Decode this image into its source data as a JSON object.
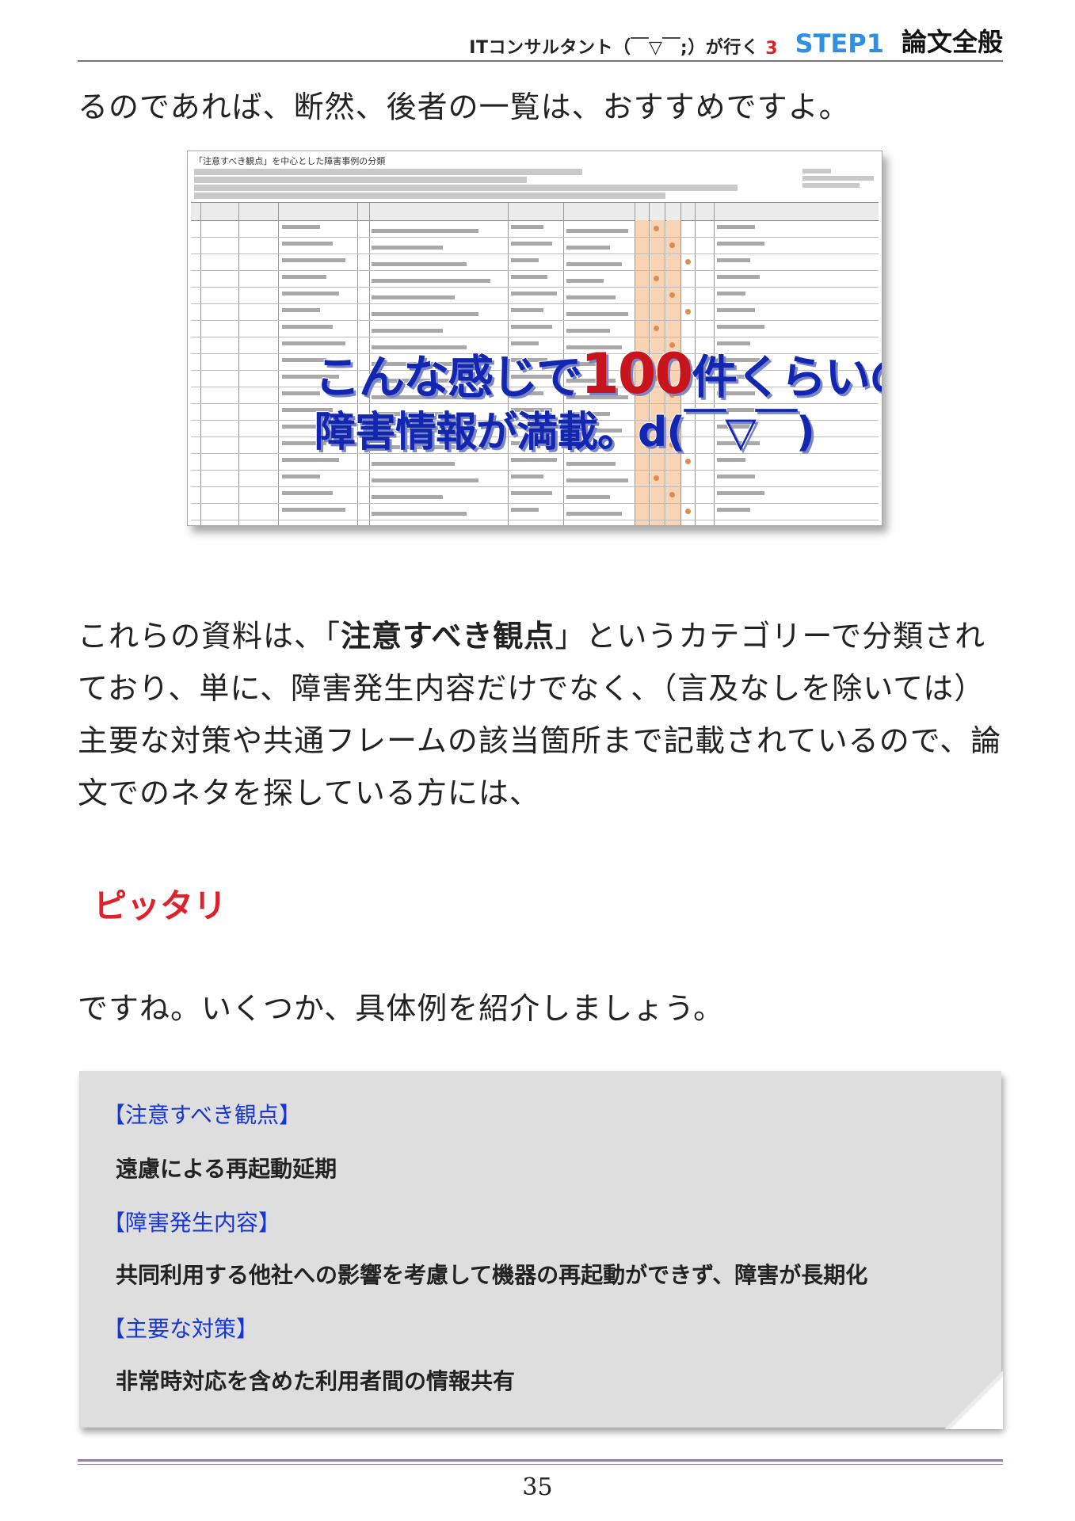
{
  "header": {
    "book_title": "ITコンサルタント（￣▽￣;）が行く",
    "volume": "3",
    "step": "STEP1",
    "chapter": "論文全般"
  },
  "paragraphs": {
    "line1": "るのであれば、断然、後者の一覧は、おすすめですよ。",
    "para2_before": "これらの資料は、「",
    "para2_strong": "注意すべき観点",
    "para2_after": "」というカテゴリーで分類されており、単に、障害発生内容だけでなく、（言及なしを除いては）主要な対策や共通フレームの該当箇所まで記載されているので、論文でのネタを探している方には、",
    "pittari": "ピッタリ",
    "closing": "ですね。いくつか、具体例を紹介しましょう。"
  },
  "figure": {
    "sheet_title": "「注意すべき観点」を中心とした障害事例の分類",
    "overlay_line1_a": "こんな感じで",
    "overlay_line1_num": "100",
    "overlay_line1_b": "件くらいの",
    "overlay_line2": "障害情報が満載。d(￣▽￣)"
  },
  "example": {
    "label1": "【注意すべき観点】",
    "value1": "遠慮による再起動延期",
    "label2": "【障害発生内容】",
    "value2": "共同利用する他社への影響を考慮して機器の再起動ができず、障害が長期化",
    "label3": "【主要な対策】",
    "value3": "非常時対応を含めた利用者間の情報共有"
  },
  "page_number": "35",
  "colors": {
    "step": "#2f8fe0",
    "volume": "#d22222",
    "pittari": "#e0202a",
    "box_label": "#1636d6",
    "box_bg": "#dedede",
    "rule": "#8f7fb0"
  }
}
